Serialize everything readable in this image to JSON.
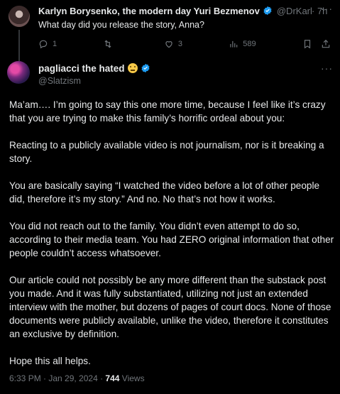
{
  "parent_tweet": {
    "display_name": "Karlyn Borysenko, the modern day Yuri Bezmenov",
    "handle": "@DrKarlynB",
    "time": "· 7h",
    "text": "What day did you release the story, Anna?",
    "stats": {
      "replies": "1",
      "retweets": "",
      "likes": "3",
      "views": "589"
    }
  },
  "main_tweet": {
    "display_name": "pagliacci the hated",
    "handle": "@Slatzism",
    "paragraphs": [
      "Ma’am…. I’m going to say this one more time, because I feel like it’s crazy that you are trying to make this family’s horrific ordeal about you:",
      "Reacting to a publicly available video is not journalism, nor is it breaking a story.",
      "You are basically saying “I watched the video before a lot of other people did, therefore it’s my story.” And no. No that’s not how it works.",
      "You did not reach out to the family. You didn’t even attempt to do so, according to their media team. You had ZERO original information that other people couldn’t access whatsoever.",
      "Our article could not possibly be any more different than the substack post you made. And it was fully substantiated, utilizing not just an extended interview with the mother, but dozens of pages of court docs. None of those documents were publicly available, unlike the video, therefore it constitutes an exclusive by definition.",
      "Hope this all helps."
    ],
    "timestamp": "6:33 PM · Jan 29, 2024 · ",
    "views_count": "744",
    "views_label": " Views"
  },
  "colors": {
    "background": "#000000",
    "text": "#e7e9ea",
    "muted": "#71767b",
    "verified": "#1d9bf0"
  },
  "icons": [
    "more-icon",
    "reply-icon",
    "retweet-icon",
    "like-icon",
    "views-icon",
    "bookmark-icon",
    "share-icon",
    "verified-icon",
    "emoji-icon"
  ]
}
